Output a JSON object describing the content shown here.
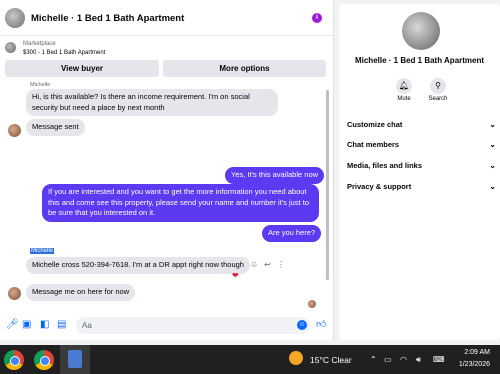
{
  "header": {
    "title": "Michelle · 1 Bed 1 Bath Apartment",
    "info_icon": "info-icon"
  },
  "marketplace": {
    "label": "Marketplace",
    "listing": "$300 - 1 Bed 1 Bath Apartment"
  },
  "buttons": {
    "view_buyer": "View buyer",
    "more_options": "More options"
  },
  "messages": [
    {
      "sender": "Michelle",
      "direction": "incoming",
      "text": "Hi, is this available? Is there an income requirement. I'm on social security but need a place by next month"
    },
    {
      "direction": "incoming",
      "text": "Message sent"
    },
    {
      "direction": "outgoing",
      "text": "Yes, It's this available now"
    },
    {
      "direction": "outgoing",
      "text": "If you are interested and you want to get the more information you need about this and come see this property, please send your name and number it's just to be sure that you interested on it."
    },
    {
      "direction": "outgoing",
      "text": "Are you here?"
    },
    {
      "sender": "Michelle",
      "direction": "incoming",
      "text": "Michelle cross 520-394-7618. I'm at a DR appt right now though",
      "reaction": "❤"
    },
    {
      "direction": "incoming",
      "text": "Message me on here for now"
    }
  ],
  "composer": {
    "placeholder": "Aa"
  },
  "info_panel": {
    "title": "Michelle · 1 Bed 1 Bath Apartment",
    "actions": [
      {
        "label": "Mute",
        "icon": "bell-icon"
      },
      {
        "label": "Search",
        "icon": "search-icon"
      }
    ],
    "menu": [
      "Customize chat",
      "Chat members",
      "Media, files and links",
      "Privacy & support"
    ]
  },
  "taskbar": {
    "weather": "15°C  Clear",
    "time": "2:09 AM",
    "date": "1/23/2026"
  },
  "colors": {
    "outgoing_bubble": "#5b3af2",
    "incoming_bubble": "#e4e6eb",
    "accent": "#0866ff",
    "info_icon": "#9b1bd8"
  }
}
